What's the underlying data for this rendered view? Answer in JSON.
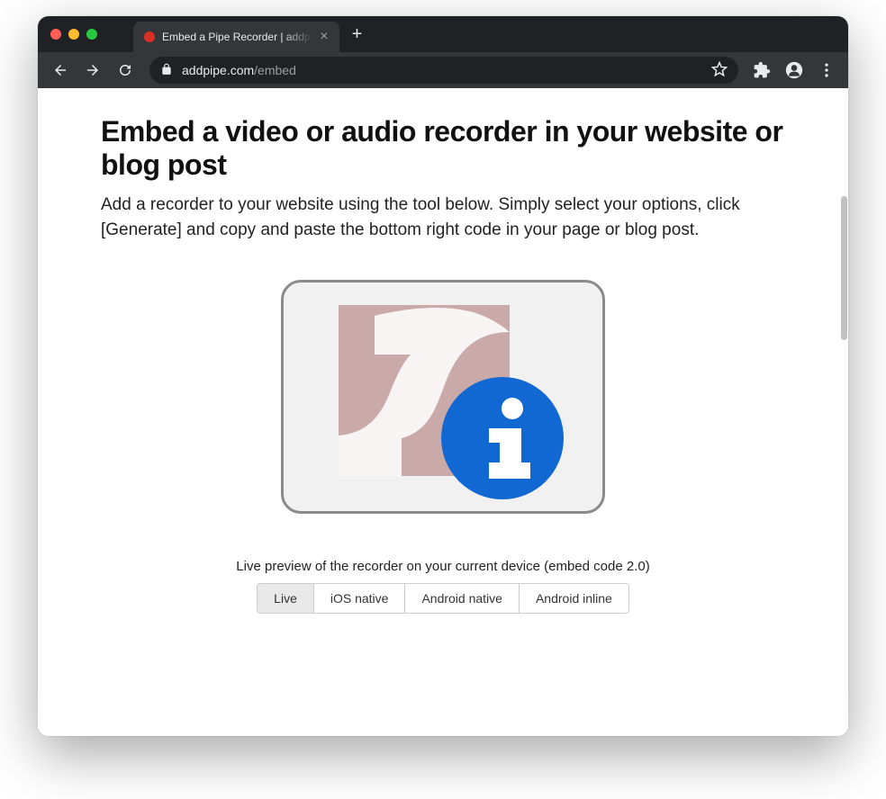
{
  "browser": {
    "tab_title": "Embed a Pipe Recorder | addpi",
    "url_host": "addpipe.com",
    "url_path": "/embed"
  },
  "page": {
    "heading": "Embed a video or audio recorder in your website or blog post",
    "description": "Add a recorder to your website using the tool below. Simply select your options, click [Generate] and copy and paste the bottom right code in your page or blog post.",
    "preview_label": "Live preview of the recorder on your current device (embed code 2.0)",
    "tabs": [
      {
        "label": "Live",
        "active": true
      },
      {
        "label": "iOS native",
        "active": false
      },
      {
        "label": "Android native",
        "active": false
      },
      {
        "label": "Android inline",
        "active": false
      }
    ]
  },
  "icons": {
    "plugin": "flash-info"
  }
}
